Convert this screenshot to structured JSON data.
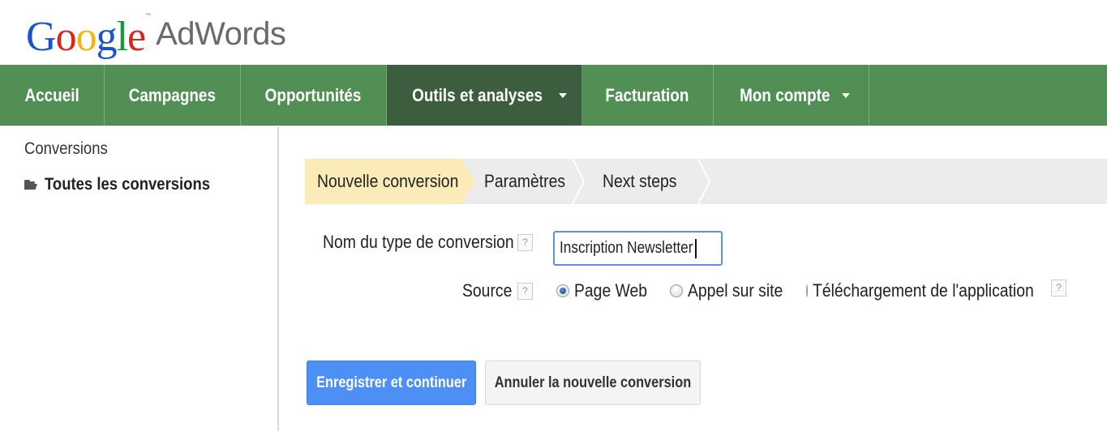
{
  "logo": {
    "google_letters": [
      "G",
      "o",
      "o",
      "g",
      "l",
      "e"
    ],
    "tm": "™",
    "product": "AdWords"
  },
  "nav": {
    "items": [
      {
        "label": "Accueil",
        "active": false,
        "dropdown": false
      },
      {
        "label": "Campagnes",
        "active": false,
        "dropdown": false
      },
      {
        "label": "Opportunités",
        "active": false,
        "dropdown": false
      },
      {
        "label": "Outils et analyses",
        "active": true,
        "dropdown": true
      },
      {
        "label": "Facturation",
        "active": false,
        "dropdown": false
      },
      {
        "label": "Mon compte",
        "active": false,
        "dropdown": true
      }
    ],
    "colors": {
      "background": "#528f54",
      "active": "#3d5e3e",
      "text": "#ffffff"
    }
  },
  "sidebar": {
    "title": "Conversions",
    "items": [
      {
        "label": "Toutes les conversions",
        "icon": "folder-icon"
      }
    ]
  },
  "steps": {
    "items": [
      {
        "label": "Nouvelle conversion",
        "active": true
      },
      {
        "label": "Paramètres",
        "active": false
      },
      {
        "label": "Next steps",
        "active": false
      }
    ],
    "colors": {
      "active": "#fbebb8",
      "inactive": "#ececec"
    }
  },
  "form": {
    "name": {
      "label": "Nom du type de conversion",
      "help": "?",
      "value": "Inscription Newsletter"
    },
    "source": {
      "label": "Source",
      "help": "?",
      "options": [
        {
          "label": "Page Web",
          "checked": true
        },
        {
          "label": "Appel sur site",
          "checked": false
        },
        {
          "label": "Téléchargement de l'application",
          "checked": false
        }
      ],
      "options_help": "?"
    }
  },
  "buttons": {
    "save": "Enregistrer et continuer",
    "cancel": "Annuler la nouvelle conversion",
    "colors": {
      "primary": "#4d8ff5",
      "secondary": "#f4f4f4"
    }
  }
}
